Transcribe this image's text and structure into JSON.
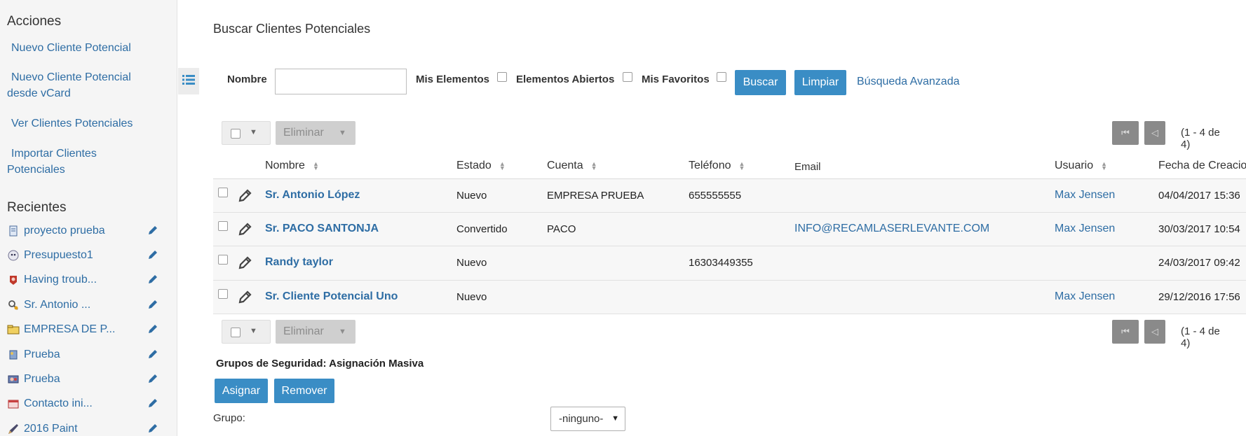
{
  "sidebar": {
    "actions_heading": "Acciones",
    "actions": [
      {
        "line1": "Nuevo Cliente Potencial",
        "line2": ""
      },
      {
        "line1": "Nuevo Cliente Potencial",
        "line2": "desde vCard"
      },
      {
        "line1": "Ver Clientes Potenciales",
        "line2": ""
      },
      {
        "line1": "Importar Clientes",
        "line2": "Potenciales"
      }
    ],
    "recent_heading": "Recientes",
    "recent": [
      {
        "label": "proyecto prueba",
        "icon": "project-icon"
      },
      {
        "label": "Presupuesto1",
        "icon": "quote-icon"
      },
      {
        "label": "Having troub...",
        "icon": "case-icon"
      },
      {
        "label": "Sr. Antonio ...",
        "icon": "lead-icon"
      },
      {
        "label": "EMPRESA DE P...",
        "icon": "account-icon"
      },
      {
        "label": "Prueba",
        "icon": "document-icon"
      },
      {
        "label": "Prueba",
        "icon": "campaign-icon"
      },
      {
        "label": "Contacto ini...",
        "icon": "meeting-icon"
      },
      {
        "label": "2016 Paint",
        "icon": "pen-icon"
      }
    ]
  },
  "main": {
    "title": "Buscar Clientes Potenciales",
    "search": {
      "name_label": "Nombre",
      "name_value": "",
      "my_items_label": "Mis Elementos",
      "open_items_label": "Elementos Abiertos",
      "favorites_label": "Mis Favoritos",
      "search_button": "Buscar",
      "clear_button": "Limpiar",
      "advanced_link": "Búsqueda Avanzada"
    },
    "toolbar": {
      "delete_label": "Eliminar",
      "pagination": "(1 - 4 de 4)"
    },
    "columns": {
      "name": "Nombre",
      "status": "Estado",
      "account": "Cuenta",
      "phone": "Teléfono",
      "email": "Email",
      "user": "Usuario",
      "created": "Fecha de Creacio"
    },
    "rows": [
      {
        "name": "Sr. Antonio López",
        "status": "Nuevo",
        "account": "EMPRESA PRUEBA",
        "phone": "655555555",
        "email": "",
        "user": "Max Jensen",
        "created": "04/04/2017 15:36"
      },
      {
        "name": "Sr. PACO SANTONJA",
        "status": "Convertido",
        "account": "PACO",
        "phone": "",
        "email": "INFO@RECAMLASERLEVANTE.COM",
        "user": "Max Jensen",
        "created": "30/03/2017 10:54"
      },
      {
        "name": "Randy taylor",
        "status": "Nuevo",
        "account": "",
        "phone": "16303449355",
        "email": "",
        "user": "",
        "created": "24/03/2017 09:42"
      },
      {
        "name": "Sr. Cliente Potencial Uno",
        "status": "Nuevo",
        "account": "",
        "phone": "",
        "email": "",
        "user": "Max Jensen",
        "created": "29/12/2016 17:56"
      }
    ],
    "security": {
      "title": "Grupos de Seguridad: Asignación Masiva",
      "assign_button": "Asignar",
      "remove_button": "Remover",
      "group_label": "Grupo:",
      "group_value": "-ninguno-"
    }
  },
  "colors": {
    "accent": "#3a8dc5",
    "link": "#2e6da4"
  }
}
